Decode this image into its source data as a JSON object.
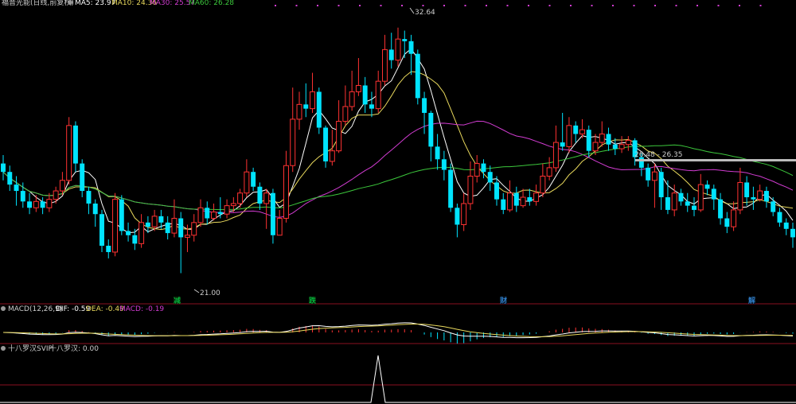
{
  "header": {
    "title": "福晋光能(日线,前复权)",
    "ma5": "MA5: 23.97",
    "ma10": "MA10: 24.36",
    "ma30": "MA30: 25.57",
    "ma60": "MA60: 26.28"
  },
  "price_labels": {
    "high": "32.64",
    "low": "21.00",
    "range": "26.48 - 26.35"
  },
  "markers": [
    "减",
    "跌",
    "财",
    "解"
  ],
  "macd": {
    "title": "MACD(12,26,9)",
    "dif": "DIF: -0.59",
    "dea": "DEA: -0.49",
    "macd": "MACD: -0.19"
  },
  "lower": {
    "title": "十八罗汉SVIP",
    "value": "十八罗汉: 0.00"
  },
  "colors": {
    "up": "#ff3232",
    "down": "#00e4ff",
    "ma5": "#ffffff",
    "ma10": "#e8d85c",
    "ma30": "#d23cd2",
    "ma60": "#3cc83c",
    "dea": "#e8d85c",
    "divider": "#8a1020",
    "marker": "#00e04c"
  },
  "chart_data": {
    "type": "candlestick",
    "yrange": [
      20,
      33.5
    ],
    "candles": [
      [
        26.2,
        25.8,
        26.6,
        25.4
      ],
      [
        25.8,
        25.2,
        26.1,
        24.9
      ],
      [
        25.2,
        24.9,
        25.6,
        24.2
      ],
      [
        24.9,
        24.4,
        25.3,
        24.1
      ],
      [
        24.4,
        24.1,
        24.8,
        23.8
      ],
      [
        24.1,
        24.4,
        24.7,
        23.9
      ],
      [
        24.4,
        24.1,
        24.6,
        23.8
      ],
      [
        24.1,
        24.5,
        24.8,
        23.9
      ],
      [
        24.5,
        24.9,
        25.1,
        24.3
      ],
      [
        24.9,
        25.4,
        25.8,
        24.7
      ],
      [
        25.4,
        28.0,
        28.4,
        25.2
      ],
      [
        28.0,
        26.2,
        28.2,
        25.8
      ],
      [
        26.2,
        24.9,
        26.4,
        24.6
      ],
      [
        24.9,
        24.3,
        25.1,
        23.8
      ],
      [
        24.3,
        23.8,
        24.5,
        23.2
      ],
      [
        23.8,
        22.3,
        24.0,
        22.0
      ],
      [
        22.3,
        22.0,
        22.6,
        21.7
      ],
      [
        22.0,
        24.5,
        24.8,
        21.8
      ],
      [
        24.5,
        23.0,
        24.7,
        22.8
      ],
      [
        23.0,
        22.8,
        23.4,
        22.5
      ],
      [
        22.8,
        22.4,
        23.1,
        22.1
      ],
      [
        22.4,
        23.4,
        23.8,
        22.2
      ],
      [
        23.4,
        23.2,
        23.7,
        22.9
      ],
      [
        23.2,
        23.7,
        24.0,
        23.0
      ],
      [
        23.7,
        23.4,
        24.0,
        23.1
      ],
      [
        23.4,
        22.9,
        23.7,
        22.6
      ],
      [
        22.9,
        23.6,
        24.5,
        22.7
      ],
      [
        23.6,
        22.7,
        23.9,
        21.0
      ],
      [
        22.7,
        22.8,
        23.3,
        22.0
      ],
      [
        22.8,
        23.4,
        23.8,
        22.5
      ],
      [
        23.4,
        24.1,
        24.5,
        23.2
      ],
      [
        24.1,
        23.6,
        24.4,
        23.3
      ],
      [
        23.6,
        23.9,
        24.3,
        23.5
      ],
      [
        23.9,
        23.8,
        24.6,
        23.6
      ],
      [
        23.8,
        24.2,
        24.5,
        23.6
      ],
      [
        24.2,
        24.3,
        24.6,
        23.9
      ],
      [
        24.3,
        24.8,
        25.0,
        24.1
      ],
      [
        24.8,
        25.8,
        26.4,
        24.6
      ],
      [
        25.8,
        25.1,
        26.0,
        24.9
      ],
      [
        25.1,
        24.3,
        25.3,
        24.0
      ],
      [
        24.3,
        24.8,
        25.0,
        23.1
      ],
      [
        24.8,
        22.8,
        25.0,
        22.4
      ],
      [
        22.8,
        23.6,
        24.0,
        22.9
      ],
      [
        23.6,
        26.1,
        26.8,
        23.4
      ],
      [
        26.1,
        28.3,
        29.8,
        25.8
      ],
      [
        28.3,
        29.0,
        29.6,
        27.8
      ],
      [
        29.0,
        28.8,
        30.0,
        28.4
      ],
      [
        28.8,
        29.6,
        30.5,
        28.6
      ],
      [
        29.6,
        27.9,
        29.8,
        27.6
      ],
      [
        27.9,
        26.3,
        28.0,
        26.0
      ],
      [
        26.3,
        26.8,
        27.8,
        26.1
      ],
      [
        26.8,
        28.2,
        29.2,
        26.7
      ],
      [
        28.2,
        28.9,
        29.9,
        28.0
      ],
      [
        28.9,
        29.6,
        30.6,
        28.7
      ],
      [
        29.6,
        29.9,
        31.2,
        29.4
      ],
      [
        29.9,
        29.0,
        30.3,
        28.6
      ],
      [
        29.0,
        28.8,
        29.6,
        28.4
      ],
      [
        28.8,
        30.1,
        30.6,
        28.6
      ],
      [
        30.1,
        31.6,
        32.3,
        29.9
      ],
      [
        31.6,
        31.1,
        32.4,
        30.7
      ],
      [
        31.1,
        32.1,
        32.64,
        30.8
      ],
      [
        32.1,
        32.0,
        32.5,
        31.2
      ],
      [
        32.0,
        31.4,
        32.3,
        30.4
      ],
      [
        31.4,
        29.3,
        31.6,
        29.0
      ],
      [
        29.3,
        28.6,
        29.6,
        27.6
      ],
      [
        28.6,
        27.0,
        28.7,
        26.3
      ],
      [
        27.0,
        26.4,
        27.6,
        25.9
      ],
      [
        26.4,
        25.9,
        26.8,
        25.4
      ],
      [
        25.9,
        24.1,
        26.2,
        23.9
      ],
      [
        24.1,
        23.3,
        24.3,
        22.7
      ],
      [
        23.3,
        24.3,
        24.8,
        23.0
      ],
      [
        24.3,
        25.6,
        26.3,
        24.0
      ],
      [
        25.6,
        26.2,
        26.6,
        25.3
      ],
      [
        26.2,
        25.8,
        26.4,
        25.5
      ],
      [
        25.8,
        25.3,
        26.1,
        24.9
      ],
      [
        25.3,
        24.5,
        25.6,
        24.2
      ],
      [
        24.5,
        24.0,
        24.8,
        23.8
      ],
      [
        24.0,
        24.8,
        25.4,
        23.9
      ],
      [
        24.8,
        24.2,
        25.1,
        23.9
      ],
      [
        24.2,
        24.6,
        25.0,
        24.1
      ],
      [
        24.6,
        24.4,
        25.0,
        24.2
      ],
      [
        24.4,
        24.8,
        25.2,
        24.2
      ],
      [
        24.8,
        25.6,
        26.2,
        24.6
      ],
      [
        25.6,
        26.0,
        26.5,
        25.4
      ],
      [
        26.0,
        27.2,
        28.0,
        25.8
      ],
      [
        27.2,
        27.0,
        28.6,
        26.8
      ],
      [
        27.0,
        28.0,
        28.4,
        26.7
      ],
      [
        28.0,
        27.6,
        28.2,
        27.2
      ],
      [
        27.6,
        27.8,
        28.3,
        27.4
      ],
      [
        27.8,
        26.8,
        28.0,
        26.5
      ],
      [
        26.8,
        27.2,
        27.6,
        26.6
      ],
      [
        27.2,
        27.6,
        28.2,
        27.0
      ],
      [
        27.6,
        27.1,
        27.9,
        26.8
      ],
      [
        27.1,
        26.9,
        27.4,
        26.6
      ],
      [
        26.9,
        27.1,
        27.5,
        26.7
      ],
      [
        27.1,
        27.3,
        27.5,
        26.8
      ],
      [
        27.3,
        26.5,
        27.4,
        26.1
      ],
      [
        26.5,
        26.0,
        26.7,
        25.6
      ],
      [
        26.0,
        25.4,
        26.2,
        25.1
      ],
      [
        25.4,
        25.8,
        26.2,
        24.1
      ],
      [
        25.8,
        24.6,
        26.0,
        24.0
      ],
      [
        24.6,
        24.0,
        25.4,
        23.8
      ],
      [
        24.0,
        24.8,
        25.2,
        23.7
      ],
      [
        24.8,
        24.4,
        25.0,
        24.2
      ],
      [
        24.4,
        24.2,
        24.8,
        23.9
      ],
      [
        24.2,
        24.0,
        24.6,
        23.7
      ],
      [
        24.0,
        25.2,
        25.7,
        23.9
      ],
      [
        25.2,
        25.0,
        25.4,
        24.7
      ],
      [
        25.0,
        24.5,
        25.2,
        24.0
      ],
      [
        24.5,
        23.6,
        24.8,
        23.3
      ],
      [
        23.6,
        23.2,
        23.9,
        22.9
      ],
      [
        23.2,
        24.0,
        24.4,
        23.0
      ],
      [
        24.0,
        25.3,
        26.0,
        23.8
      ],
      [
        25.3,
        24.6,
        25.6,
        24.2
      ],
      [
        24.6,
        24.5,
        25.1,
        24.0
      ],
      [
        24.5,
        24.9,
        25.2,
        24.4
      ],
      [
        24.9,
        24.4,
        25.1,
        24.1
      ],
      [
        24.4,
        23.9,
        24.6,
        23.7
      ],
      [
        23.9,
        23.4,
        24.1,
        23.2
      ],
      [
        23.4,
        23.1,
        23.6,
        22.8
      ],
      [
        23.1,
        22.7,
        23.4,
        22.2
      ]
    ]
  }
}
